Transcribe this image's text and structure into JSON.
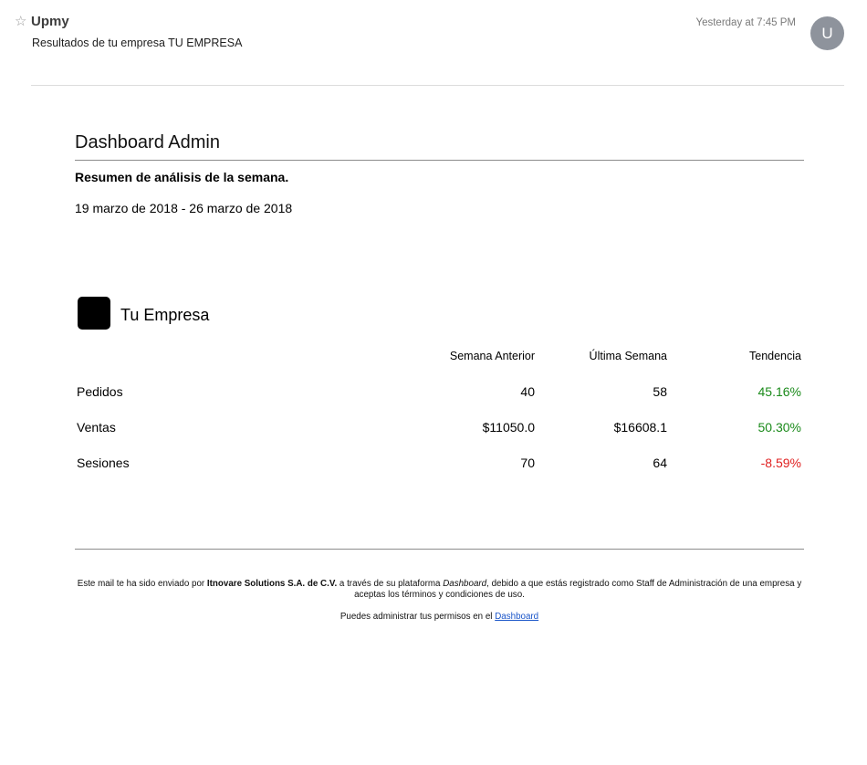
{
  "mail": {
    "star_glyph": "☆",
    "sender": "Upmy",
    "subject": "Resultados de tu empresa TU EMPRESA",
    "timestamp": "Yesterday at 7:45 PM",
    "avatar_letter": "U"
  },
  "report": {
    "title": "Dashboard Admin",
    "summary_heading": "Resumen de análisis de la semana.",
    "date_range": "19 marzo de 2018 - 26 marzo de 2018",
    "company_name": "Tu Empresa",
    "columns": [
      "Semana Anterior",
      "Última Semana",
      "Tendencia"
    ],
    "rows": [
      {
        "label": "Pedidos",
        "previous": "40",
        "last": "58",
        "trend": "45.16%"
      },
      {
        "label": "Ventas",
        "previous": "$11050.0",
        "last": "$16608.1",
        "trend": "50.30%"
      },
      {
        "label": "Sesiones",
        "previous": "70",
        "last": "64",
        "trend": "-8.59%"
      }
    ]
  },
  "footer": {
    "text_before_company": "Este mail te ha sido enviado por ",
    "company": "Itnovare Solutions S.A. de C.V.",
    "text_before_platform": " a través de su plataforma ",
    "platform": "Dashboard",
    "text_after_platform": ", debido a que estás registrado como Staff de Administración de una empresa y aceptas los términos y condiciones de uso.",
    "permissions_text": "Puedes administrar tus permisos en el ",
    "permissions_link": "Dashboard"
  },
  "colors": {
    "trend_positive": "#1a8a1a",
    "trend_negative": "#e02020",
    "avatar_bg": "#8e939c",
    "link": "#1a55c9"
  }
}
